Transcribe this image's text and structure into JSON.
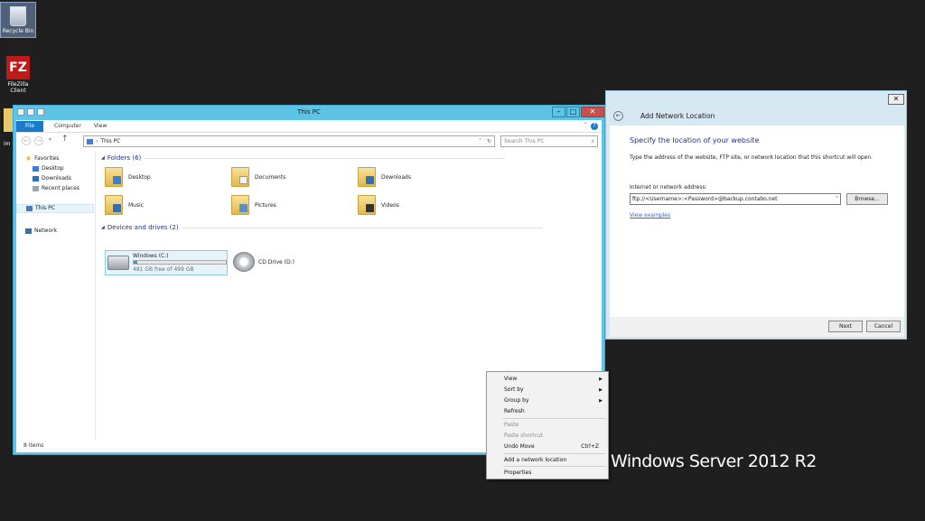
{
  "desktop": {
    "icons": [
      {
        "label": "Recycle Bin"
      },
      {
        "label": "FileZilla Client",
        "logo_text": "FZ"
      },
      {
        "label": "im"
      }
    ]
  },
  "explorer": {
    "title": "This PC",
    "ribbon_tabs": [
      "File",
      "Computer",
      "View"
    ],
    "address": "This PC",
    "search_placeholder": "Search This PC",
    "nav": {
      "favorites": "Favorites",
      "favorites_items": [
        "Desktop",
        "Downloads",
        "Recent places"
      ],
      "this_pc": "This PC",
      "network": "Network"
    },
    "folders_header": "Folders (6)",
    "folders": [
      "Desktop",
      "Documents",
      "Downloads",
      "Music",
      "Pictures",
      "Videos"
    ],
    "devices_header": "Devices and drives (2)",
    "drives": [
      {
        "name": "Windows (C:)",
        "free": "481 GB free of 499 GB",
        "used_fraction": 0.036
      },
      {
        "name": "CD Drive (D:)"
      }
    ],
    "status": "8 items"
  },
  "dialog": {
    "title": "Add Network Location",
    "heading": "Specify the location of your website",
    "description": "Type the address of the website, FTP site, or network location that this shortcut will open.",
    "address_label": "Internet or network address:",
    "address_value": "ftp://<Username>:<Password>@backup.contabo.net",
    "browse_label": "Browse...",
    "examples_link": "View examples",
    "next_label": "Next",
    "cancel_label": "Cancel"
  },
  "context_menu": {
    "view": "View",
    "sort_by": "Sort by",
    "group_by": "Group by",
    "refresh": "Refresh",
    "paste": "Paste",
    "paste_shortcut": "Paste shortcut",
    "undo_move": "Undo Move",
    "undo_shortcut": "Ctrl+Z",
    "add_network": "Add a network location",
    "properties": "Properties"
  },
  "watermark": "Windows Server 2012 R2"
}
